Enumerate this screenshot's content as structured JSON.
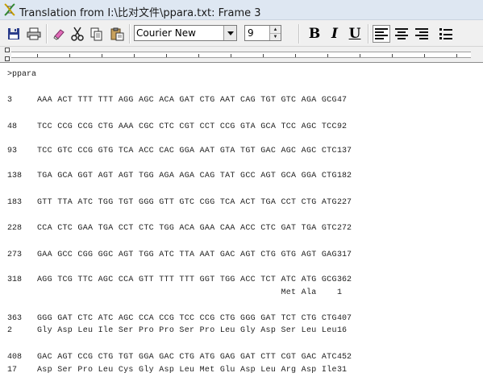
{
  "window": {
    "title": "Translation from I:\\比对文件\\ppara.txt: Frame 3"
  },
  "toolbar": {
    "font_name": "Courier New",
    "font_size": "9",
    "bold_label": "B",
    "italic_label": "I",
    "underline_label": "U"
  },
  "document": {
    "header": "ppara",
    "blocks": [
      {
        "dna": {
          "start": "3",
          "seq": "AAA ACT TTT TTT AGG AGC ACA GAT CTG AAT CAG TGT GTC AGA GCG",
          "end": "47"
        }
      },
      {
        "dna": {
          "start": "48",
          "seq": "TCC CCG CCG CTG AAA CGC CTC CGT CCT CCG GTA GCA TCC AGC TCC",
          "end": "92"
        }
      },
      {
        "dna": {
          "start": "93",
          "seq": "TCC GTC CCG GTG TCA ACC CAC GGA AAT GTA TGT GAC AGC AGC CTC",
          "end": "137"
        }
      },
      {
        "dna": {
          "start": "138",
          "seq": "TGA GCA GGT AGT AGT TGG AGA AGA CAG TAT GCC AGT GCA GGA CTG",
          "end": "182"
        }
      },
      {
        "dna": {
          "start": "183",
          "seq": "GTT TTA ATC TGG TGT GGG GTT GTC CGG TCA ACT TGA CCT CTG ATG",
          "end": "227"
        }
      },
      {
        "dna": {
          "start": "228",
          "seq": "CCA CTC GAA TGA CCT CTC TGG ACA GAA CAA ACC CTC GAT TGA GTC",
          "end": "272"
        }
      },
      {
        "dna": {
          "start": "273",
          "seq": "GAA GCC CGG GGC AGT TGG ATC TTA AAT GAC AGT CTG GTG AGT GAG",
          "end": "317"
        }
      },
      {
        "dna": {
          "start": "318",
          "seq": "AGG TCG TTC AGC CCA GTT TTT TTT GGT TGG ACC TCT ATC ATG GCG",
          "end": "362"
        },
        "protein": {
          "start": "",
          "seq": "                                                Met Ala",
          "end": "1"
        }
      },
      {
        "dna": {
          "start": "363",
          "seq": "GGG GAT CTC ATC AGC CCA CCG TCC CCG CTG GGG GAT TCT CTG CTG",
          "end": "407"
        },
        "protein": {
          "start": "2",
          "seq": "Gly Asp Leu Ile Ser Pro Pro Ser Pro Leu Gly Asp Ser Leu Leu",
          "end": "16"
        }
      },
      {
        "dna": {
          "start": "408",
          "seq": "GAC AGT CCG CTG TGT GGA GAC CTG ATG GAG GAT CTT CGT GAC ATC",
          "end": "452"
        },
        "protein": {
          "start": "17",
          "seq": "Asp Ser Pro Leu Cys Gly Asp Leu Met Glu Asp Leu Arg Asp Ile",
          "end": "31"
        }
      }
    ]
  }
}
